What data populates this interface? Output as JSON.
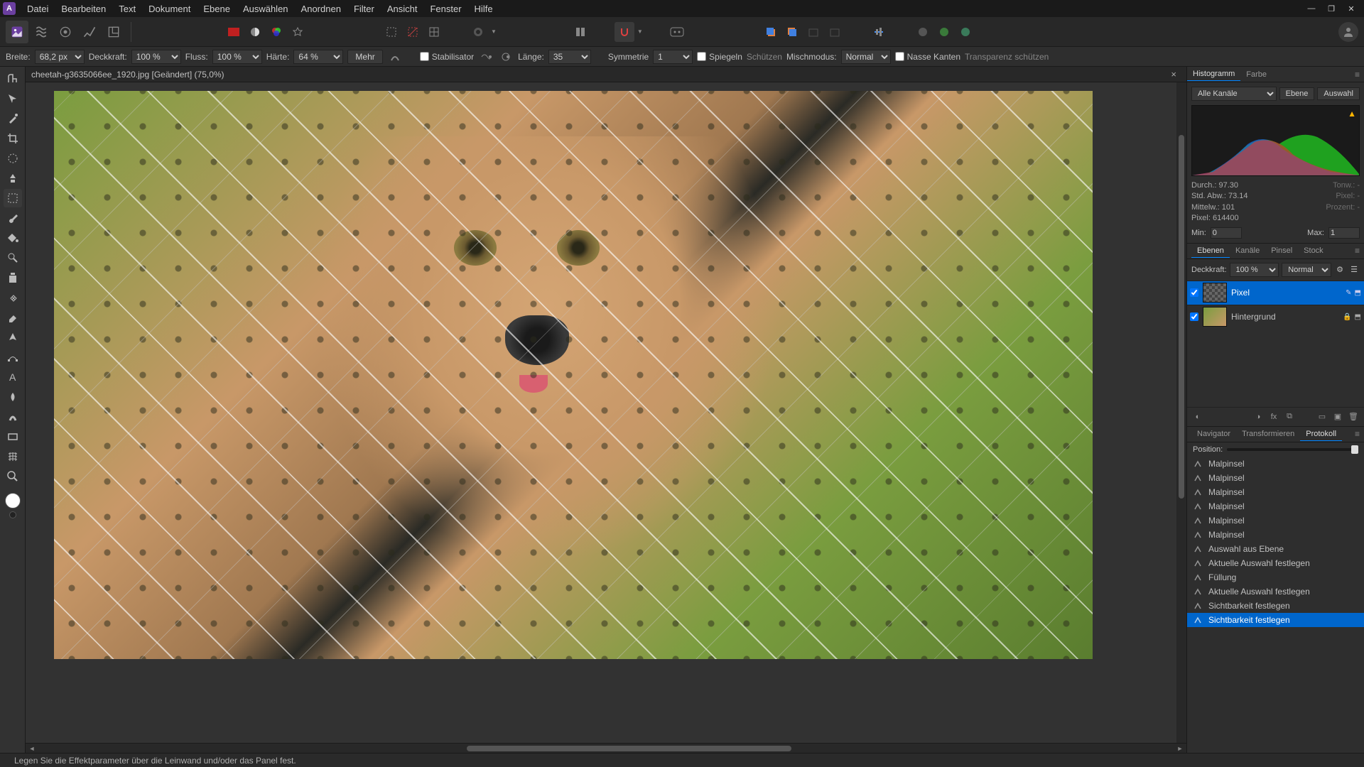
{
  "menu": [
    "Datei",
    "Bearbeiten",
    "Text",
    "Dokument",
    "Ebene",
    "Auswählen",
    "Anordnen",
    "Filter",
    "Ansicht",
    "Fenster",
    "Hilfe"
  ],
  "document": {
    "title": "cheetah-g3635066ee_1920.jpg [Geändert] (75,0%)"
  },
  "context": {
    "breite_label": "Breite:",
    "breite_value": "68,2 px",
    "deckkraft_label": "Deckkraft:",
    "deckkraft_value": "100 %",
    "fluss_label": "Fluss:",
    "fluss_value": "100 %",
    "haerte_label": "Härte:",
    "haerte_value": "64 %",
    "mehr": "Mehr",
    "stabilisator": "Stabilisator",
    "laenge_label": "Länge:",
    "laenge_value": "35",
    "symmetrie_label": "Symmetrie",
    "symmetrie_value": "1",
    "spiegeln": "Spiegeln",
    "schuetzen": "Schützen",
    "mischmodus": "Mischmodus:",
    "mischmodus_value": "Normal",
    "nasse_kanten": "Nasse Kanten",
    "transparenz": "Transparenz schützen"
  },
  "histogram": {
    "tab1": "Histogramm",
    "tab2": "Farbe",
    "channel": "Alle Kanäle",
    "btn_ebene": "Ebene",
    "btn_auswahl": "Auswahl",
    "durch": "Durch.: 97.30",
    "stdabw": "Std. Abw.: 73.14",
    "mittelw": "Mittelw.: 101",
    "pixel": "Pixel: 614400",
    "tonw": "Tonw.: -",
    "pixel2": "Pixel: -",
    "prozent": "Prozent: -",
    "min_label": "Min:",
    "min_value": "0",
    "max_label": "Max:",
    "max_value": "1"
  },
  "layers": {
    "tabs": [
      "Ebenen",
      "Kanäle",
      "Pinsel",
      "Stock"
    ],
    "deckkraft_label": "Deckkraft:",
    "deckkraft_value": "100 %",
    "blend_value": "Normal",
    "items": [
      {
        "name": "Pixel",
        "selected": true
      },
      {
        "name": "Hintergrund",
        "selected": false
      }
    ]
  },
  "history": {
    "tabs": [
      "Navigator",
      "Transformieren",
      "Protokoll"
    ],
    "position_label": "Position:",
    "items": [
      "Malpinsel",
      "Malpinsel",
      "Malpinsel",
      "Malpinsel",
      "Malpinsel",
      "Malpinsel",
      "Auswahl aus Ebene",
      "Aktuelle Auswahl festlegen",
      "Füllung",
      "Aktuelle Auswahl festlegen",
      "Sichtbarkeit festlegen",
      "Sichtbarkeit festlegen"
    ],
    "selected_index": 11
  },
  "status": "Legen Sie die Effektparameter über die Leinwand und/oder das Panel fest."
}
